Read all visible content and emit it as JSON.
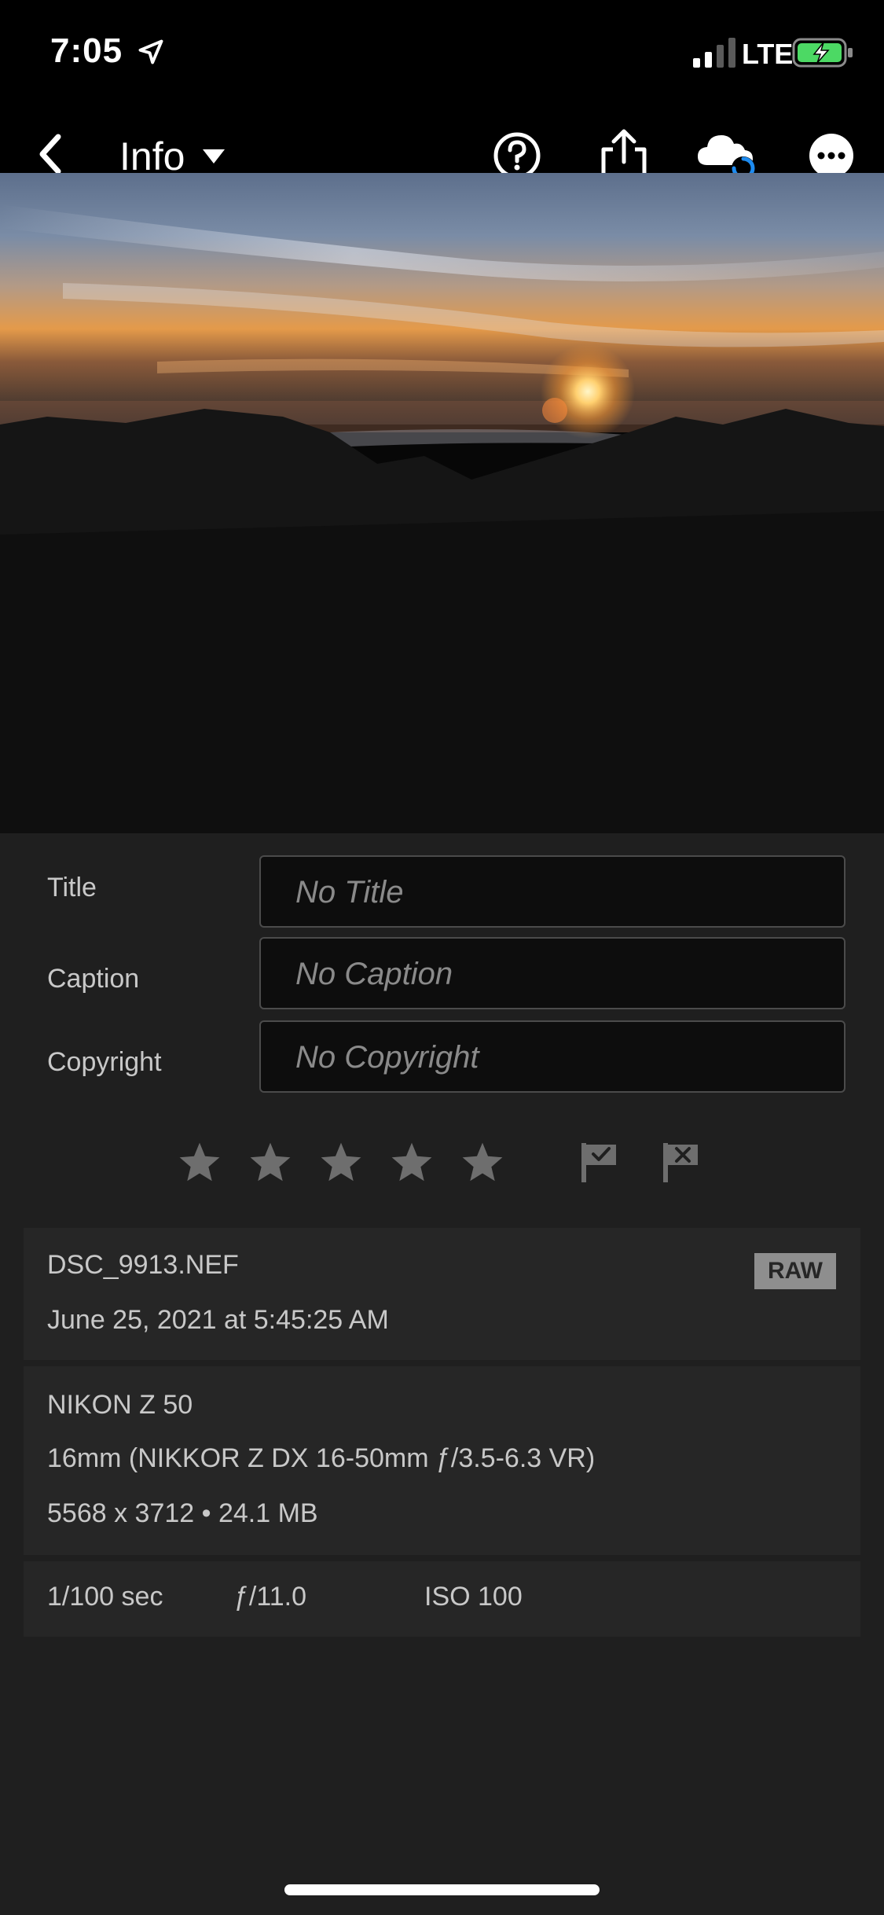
{
  "status_bar": {
    "time": "7:05",
    "network": "LTE",
    "icons": [
      "location-arrow-icon",
      "signal-icon",
      "battery-charging-icon"
    ]
  },
  "nav": {
    "title": "Info",
    "icons": [
      "back-chevron-icon",
      "caret-down-icon",
      "help-icon",
      "share-icon",
      "cloud-sync-icon",
      "more-icon"
    ]
  },
  "metadata": {
    "title_label": "Title",
    "title_placeholder": "No Title",
    "caption_label": "Caption",
    "caption_placeholder": "No Caption",
    "copyright_label": "Copyright",
    "copyright_placeholder": "No Copyright"
  },
  "rating": {
    "stars_total": 5,
    "stars_selected": 0,
    "flags": [
      "pick-flag-icon",
      "reject-flag-icon"
    ]
  },
  "file": {
    "name": "DSC_9913.NEF",
    "date": "June 25, 2021 at 5:45:25 AM",
    "badge": "RAW"
  },
  "camera": {
    "model": "NIKON Z 50",
    "lens": "16mm (NIKKOR Z DX 16-50mm ƒ/3.5-6.3 VR)",
    "dimensions": "5568 x 3712 • 24.1 MB"
  },
  "exposure": {
    "shutter": "1/100 sec",
    "aperture": "ƒ/11.0",
    "iso": "ISO 100"
  },
  "colors": {
    "background": "#1f1f1f",
    "card": "#262626",
    "field": "#0d0d0d",
    "icon_gray": "#6e6e6e",
    "sync_blue": "#1d8bf0",
    "battery_green": "#4cd964"
  }
}
